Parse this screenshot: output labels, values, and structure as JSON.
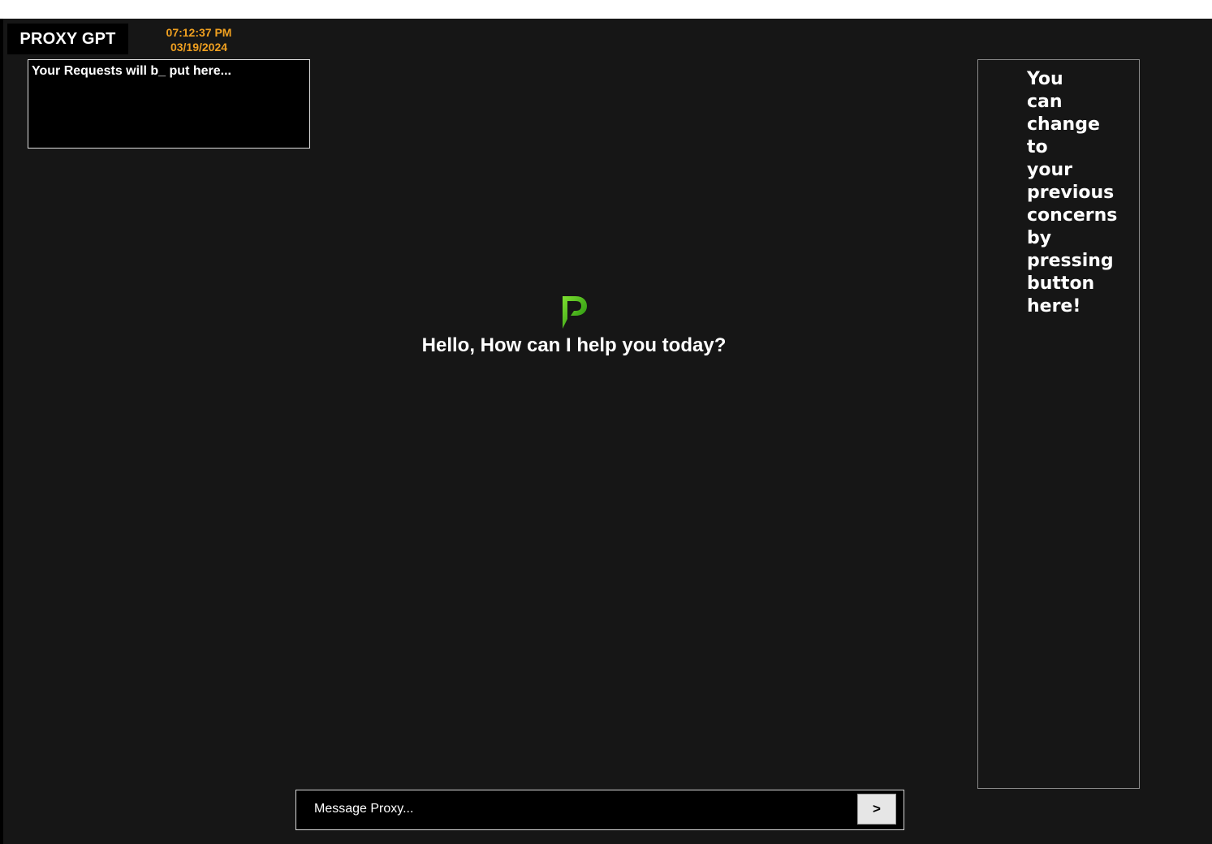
{
  "app": {
    "title": "PROXY GPT"
  },
  "clock": {
    "time": "07:12:37 PM",
    "date": "03/19/2024",
    "color": "#f0a020"
  },
  "requests": {
    "placeholder_text": "Your Requests will b_ put here..."
  },
  "greeting": {
    "logo_icon": "proxy-p-logo",
    "text": "Hello, How can I help you today?"
  },
  "history": {
    "hint": "You can change to your previous concerns by pressing button here!"
  },
  "composer": {
    "placeholder": "Message Proxy...",
    "send_label": ">"
  },
  "colors": {
    "background": "#161616",
    "panel": "#000000",
    "accent_green": "#3cb814"
  }
}
